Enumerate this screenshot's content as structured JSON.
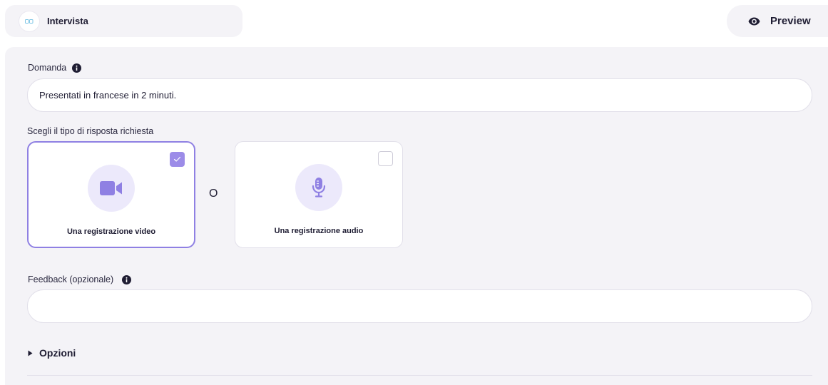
{
  "header": {
    "tab_title": "Intervista",
    "preview_label": "Preview"
  },
  "form": {
    "question": {
      "label": "Domanda",
      "value": "Presentati in francese in 2 minuti."
    },
    "response_type": {
      "label": "Scegli il tipo di risposta richiesta",
      "separator": "O",
      "options": [
        {
          "label": "Una registrazione video",
          "icon": "video-camera-icon",
          "selected": true
        },
        {
          "label": "Una registrazione audio",
          "icon": "microphone-icon",
          "selected": false
        }
      ]
    },
    "feedback": {
      "label": "Feedback (opzionale)",
      "value": ""
    },
    "options_toggle": "Opzioni"
  },
  "colors": {
    "accent": "#8f80e3",
    "accent_light": "#ece9fb",
    "panel_bg": "#f4f3f7",
    "text": "#1f1d33"
  }
}
